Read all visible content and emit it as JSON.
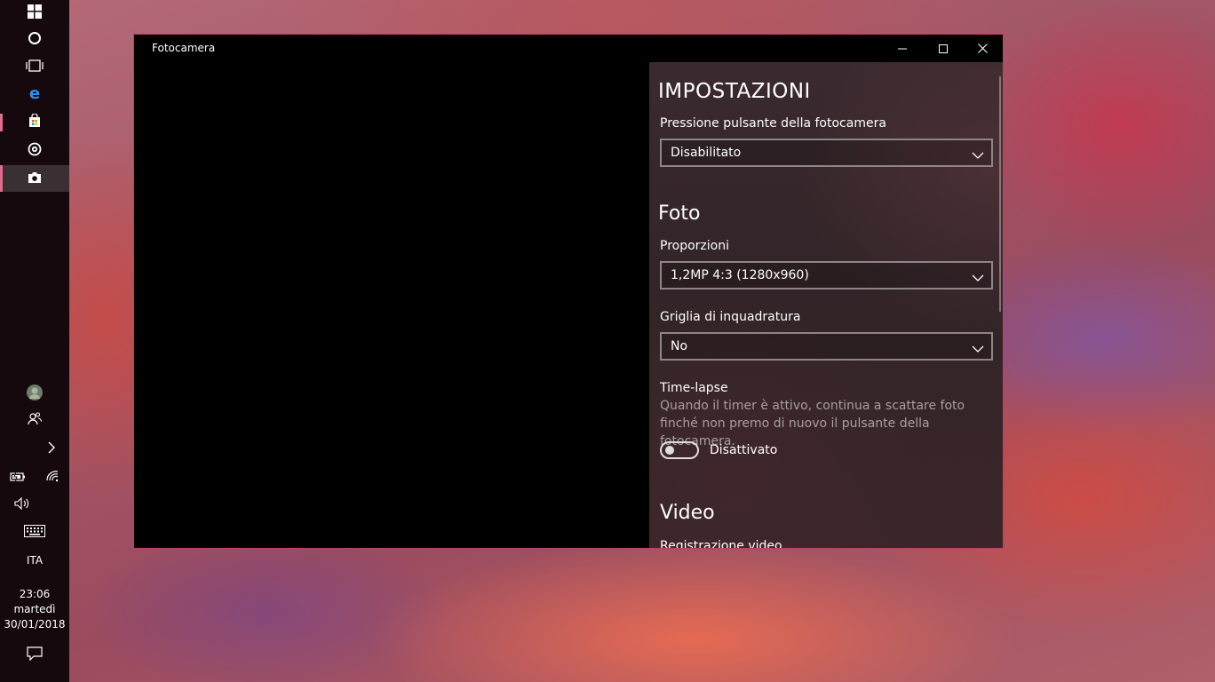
{
  "taskbar": {
    "language": "ITA",
    "time": "23:06",
    "weekday": "martedì",
    "date": "30/01/2018",
    "icons": [
      "windows-start-icon",
      "cortana-circle-icon",
      "task-view-icon",
      "edge-browser-icon",
      "store-bag-icon",
      "groove-music-icon",
      "camera-app-icon",
      "avatar",
      "people-icon",
      "chevron-right-icon",
      "battery-icon",
      "wifi-icon",
      "volume-icon",
      "keyboard-icon",
      "action-center-icon"
    ],
    "accent_color": "#e26b8f"
  },
  "window": {
    "title": "Fotocamera",
    "border_color": "#c03e66",
    "controls": [
      "minimize-icon",
      "maximize-icon",
      "close-icon"
    ]
  },
  "settings": {
    "heading": "IMPOSTAZIONI",
    "camera_button": {
      "label": "Pressione pulsante della fotocamera",
      "value": "Disabilitato"
    },
    "photo_section": "Foto",
    "aspect_ratio": {
      "label": "Proporzioni",
      "value": "1,2MP 4:3 (1280x960)"
    },
    "framing_grid": {
      "label": "Griglia di inquadratura",
      "value": "No"
    },
    "timelapse": {
      "label": "Time-lapse",
      "description": "Quando il timer è attivo, continua a scattare foto finché non premo di nuovo il pulsante della fotocamera.",
      "state": "Disattivato"
    },
    "video_section": "Video",
    "video_recording_label": "Registrazione video"
  }
}
